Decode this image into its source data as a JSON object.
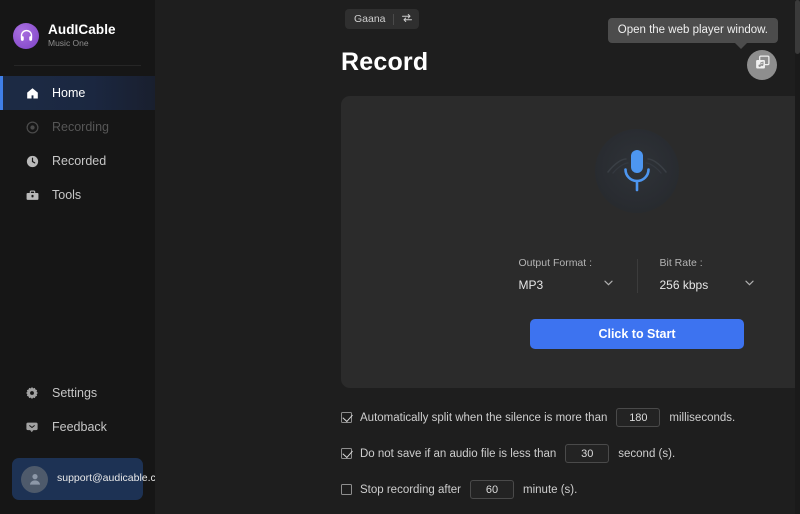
{
  "sidebar": {
    "brand": {
      "name": "AudICable",
      "subtitle": "Music One",
      "logo_icon": "headphones-icon"
    },
    "items": [
      {
        "label": "Home",
        "icon": "home-icon",
        "state": "active"
      },
      {
        "label": "Recording",
        "icon": "record-icon",
        "state": "disabled"
      },
      {
        "label": "Recorded",
        "icon": "clock-icon",
        "state": "normal"
      },
      {
        "label": "Tools",
        "icon": "toolbox-icon",
        "state": "normal"
      }
    ],
    "bottom_items": [
      {
        "label": "Settings",
        "icon": "gear-icon"
      },
      {
        "label": "Feedback",
        "icon": "chat-icon"
      }
    ],
    "support": {
      "email": "support@audicable.com",
      "avatar_icon": "user-icon"
    }
  },
  "header": {
    "source_label": "Gaana",
    "source_swap_icon": "swap-arrows-icon",
    "page_title": "Record",
    "tooltip": "Open the web player window.",
    "webplayer_icon": "web-player-window-icon"
  },
  "record": {
    "mic_icon": "microphone-icon",
    "output_format": {
      "label": "Output Format :",
      "value": "MP3",
      "chevron": "chevron-down-icon"
    },
    "bit_rate": {
      "label": "Bit Rate :",
      "value": "256 kbps",
      "chevron": "chevron-down-icon"
    },
    "start_button": "Click to Start"
  },
  "options": [
    {
      "text": "Automatically split when the silence is more than",
      "value": "180",
      "unit": "milliseconds.",
      "checked": true
    },
    {
      "text": "Do not save if an audio file is less than",
      "value": "30",
      "unit": "second (s).",
      "checked": true
    },
    {
      "text": "Stop recording after",
      "value": "60",
      "unit": "minute (s).",
      "checked": false
    }
  ],
  "colors": {
    "accent": "#3d73f0",
    "brand": "#7e43c7",
    "sidebar_bg": "#161616",
    "page_bg": "#1e1e1e",
    "card_bg": "#2b2b2b"
  }
}
